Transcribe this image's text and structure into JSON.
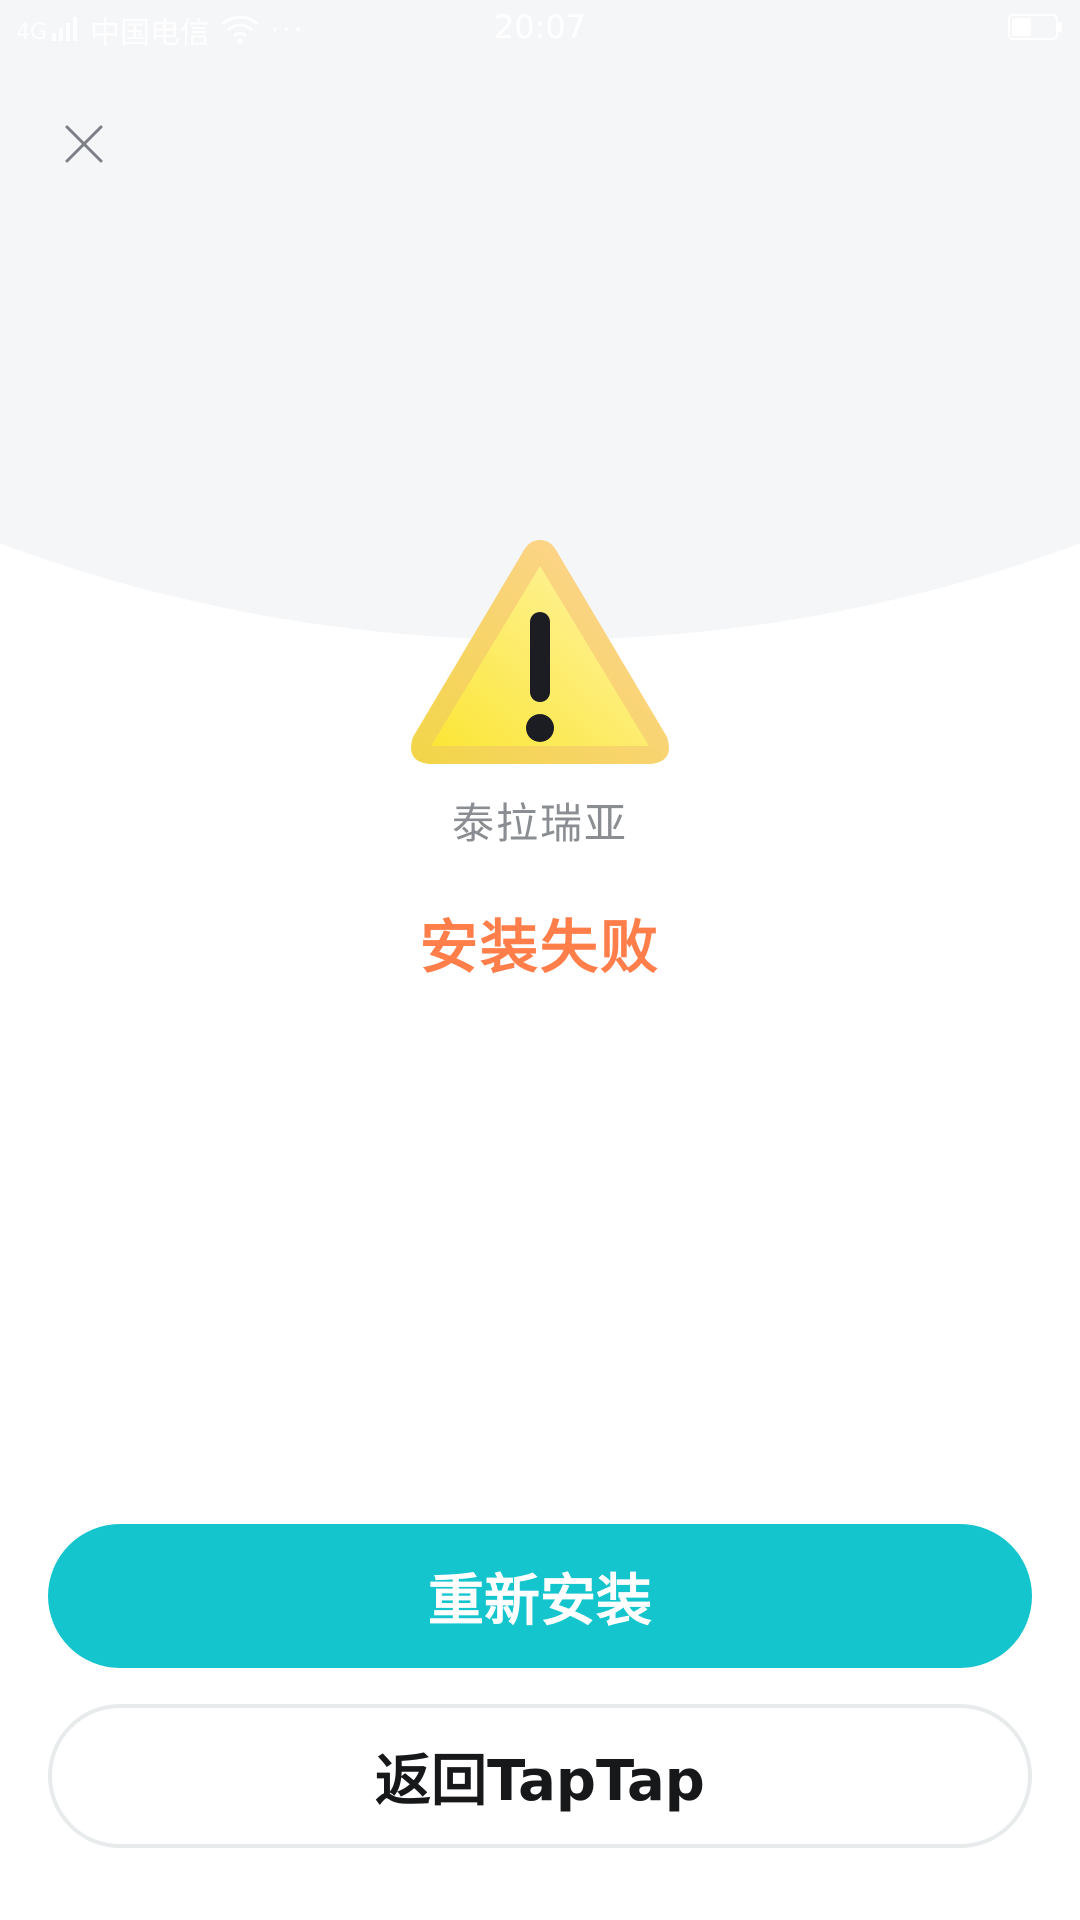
{
  "status_bar": {
    "carrier": "中国电信",
    "more": "···",
    "time": "20:07",
    "signal_icon": "signal-icon",
    "wifi_icon": "wifi-icon",
    "battery_icon": "battery-icon",
    "battery_level": 0.45
  },
  "header": {
    "close_icon": "close-icon"
  },
  "content": {
    "warning_icon": "warning-triangle-icon",
    "app_name": "泰拉瑞亚",
    "status": "安装失败"
  },
  "actions": {
    "reinstall_label": "重新安装",
    "back_label": "返回TapTap"
  },
  "colors": {
    "accent": "#15c5ce",
    "error": "#ff7e4a",
    "background": "#f5f6f8",
    "warning_fill": "#fbe84a",
    "warning_border": "#fdd68a"
  }
}
